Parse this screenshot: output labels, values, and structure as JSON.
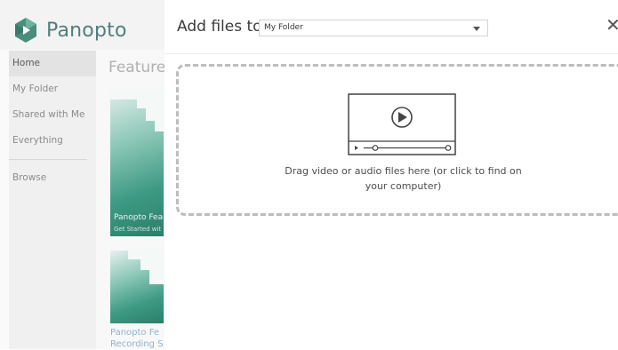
{
  "brand": {
    "name": "Panopto"
  },
  "sidebar": {
    "items": [
      {
        "label": "Home"
      },
      {
        "label": "My Folder"
      },
      {
        "label": "Shared with Me"
      },
      {
        "label": "Everything"
      },
      {
        "label": "Browse"
      }
    ]
  },
  "main": {
    "featured_title": "Featured",
    "cards": [
      {
        "title": "Panopto Fea",
        "subtitle": "Get Started wit"
      },
      {
        "title": "Panopto Fe",
        "subtitle": "Recording S"
      }
    ]
  },
  "modal": {
    "title": "Add files to",
    "folder_select": {
      "value": "My Folder"
    },
    "close_label": "✕",
    "dropzone_text": "Drag video or audio files here (or click to find on your computer)"
  }
}
